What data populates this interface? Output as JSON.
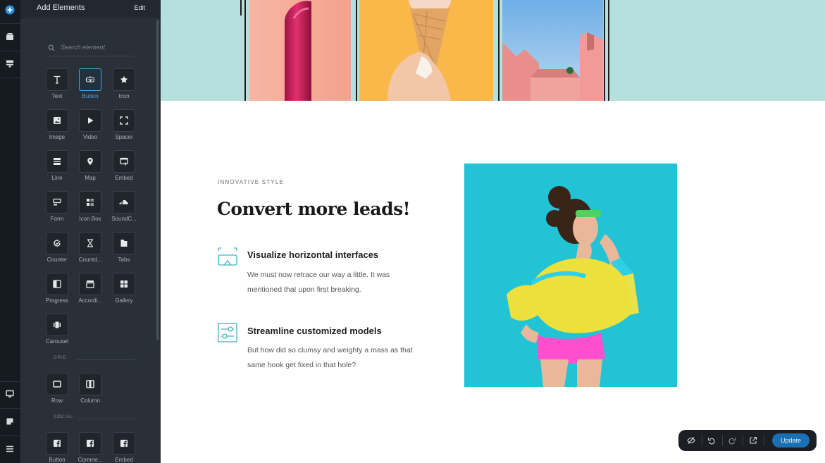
{
  "panel": {
    "title": "Add Elements",
    "edit_label": "Edit",
    "search_placeholder": "Search element"
  },
  "elements": [
    {
      "label": "Text",
      "icon": "text-icon"
    },
    {
      "label": "Button",
      "icon": "button-icon",
      "active": true
    },
    {
      "label": "Icon",
      "icon": "star-icon"
    },
    {
      "label": "Image",
      "icon": "image-icon"
    },
    {
      "label": "Video",
      "icon": "play-icon"
    },
    {
      "label": "Spacer",
      "icon": "spacer-icon"
    },
    {
      "label": "Line",
      "icon": "line-icon"
    },
    {
      "label": "Map",
      "icon": "map-pin-icon"
    },
    {
      "label": "Embed",
      "icon": "embed-icon"
    },
    {
      "label": "Form",
      "icon": "form-icon"
    },
    {
      "label": "Icon Box",
      "icon": "icon-box-icon"
    },
    {
      "label": "SoundC...",
      "icon": "soundcloud-icon"
    },
    {
      "label": "Counter",
      "icon": "counter-icon"
    },
    {
      "label": "Countd...",
      "icon": "hourglass-icon"
    },
    {
      "label": "Tabs",
      "icon": "tabs-icon"
    },
    {
      "label": "Progress",
      "icon": "progress-icon"
    },
    {
      "label": "Accordi...",
      "icon": "accordion-icon"
    },
    {
      "label": "Gallery",
      "icon": "gallery-icon"
    },
    {
      "label": "Carousel",
      "icon": "carousel-icon"
    }
  ],
  "grid_section": {
    "label": "GRID",
    "items": [
      {
        "label": "Row",
        "icon": "row-icon"
      },
      {
        "label": "Column",
        "icon": "column-icon"
      }
    ]
  },
  "social_section": {
    "label": "SOCIAL",
    "items": [
      {
        "label": "Button",
        "icon": "facebook-icon"
      },
      {
        "label": "Comme...",
        "icon": "facebook-icon"
      },
      {
        "label": "Embed",
        "icon": "facebook-icon"
      }
    ]
  },
  "content": {
    "eyebrow": "INNOVATIVE STYLE",
    "headline": "Convert more leads!",
    "features": [
      {
        "title": "Visualize horizontal interfaces",
        "line1": "We must now retrace our way a little. It was",
        "line2": "mentioned that upon first breaking.",
        "icon": "vr-headset-icon"
      },
      {
        "title": "Streamline customized models",
        "line1": "But how did so clumsy and weighty a mass as that",
        "line2": "same hook get fixed in that hole?",
        "icon": "sliders-icon"
      }
    ]
  },
  "toolbar": {
    "update_label": "Update"
  },
  "colors": {
    "accent": "#4aa3df",
    "hero_bg": "#b6e0dd",
    "feature_icon": "#3fb3c4",
    "update_bg": "#1b6fb3"
  }
}
